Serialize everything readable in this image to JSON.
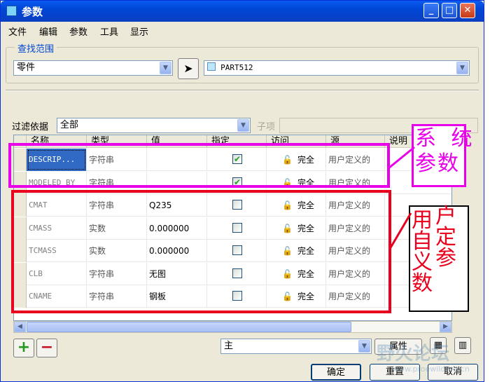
{
  "window": {
    "title": "参数"
  },
  "titlebar_buttons": {
    "minimize": "_",
    "maximize": "□",
    "close": "✕"
  },
  "menu": [
    "文件",
    "编辑",
    "参数",
    "工具",
    "显示"
  ],
  "scope": {
    "group_label": "查找范围",
    "type_value": "零件",
    "part_value": "PART512"
  },
  "filter": {
    "label": "过滤依据",
    "value": "全部",
    "sub_label": "子项"
  },
  "table": {
    "columns": [
      "名称",
      "类型",
      "值",
      "指定",
      "访问",
      "源",
      "说明"
    ],
    "rows": [
      {
        "name": "DESCRIP...",
        "type": "字符串",
        "value": "",
        "designated": true,
        "access": "完全",
        "source": "用户定义的",
        "selected": true
      },
      {
        "name": "MODELED_BY",
        "type": "字符串",
        "value": "",
        "designated": true,
        "access": "完全",
        "source": "用户定义的",
        "selected": false
      },
      {
        "name": "CMAT",
        "type": "字符串",
        "value": "Q235",
        "designated": false,
        "access": "完全",
        "source": "用户定义的",
        "selected": false
      },
      {
        "name": "CMASS",
        "type": "实数",
        "value": "0.000000",
        "designated": false,
        "access": "完全",
        "source": "用户定义的",
        "selected": false
      },
      {
        "name": "TCMASS",
        "type": "实数",
        "value": "0.000000",
        "designated": false,
        "access": "完全",
        "source": "用户定义的",
        "selected": false
      },
      {
        "name": "CLB",
        "type": "字符串",
        "value": "无图",
        "designated": false,
        "access": "完全",
        "source": "用户定义的",
        "selected": false
      },
      {
        "name": "CNAME",
        "type": "字符串",
        "value": "钢板",
        "designated": false,
        "access": "完全",
        "source": "用户定义的",
        "selected": false
      }
    ]
  },
  "bottom": {
    "add": "+",
    "remove": "−",
    "main_select": "主",
    "properties": "属性"
  },
  "dialog_buttons": {
    "ok": "确定",
    "reset": "重置",
    "cancel": "取消"
  },
  "annotations": {
    "system_label": "系统参数",
    "system_line1": "系 统",
    "system_line2": "参数",
    "user_label": "用户自定义参数",
    "user_col1": [
      "用",
      "自",
      "义",
      "数"
    ],
    "user_col2": [
      "户",
      "定",
      "参"
    ]
  },
  "watermark": {
    "text": "野火论坛",
    "url": "www.proewildfire.cn"
  },
  "colors": {
    "magenta": "#e800e8",
    "red": "#e8001c",
    "selection": "#316ac5",
    "titlebar": "#0054e3"
  }
}
